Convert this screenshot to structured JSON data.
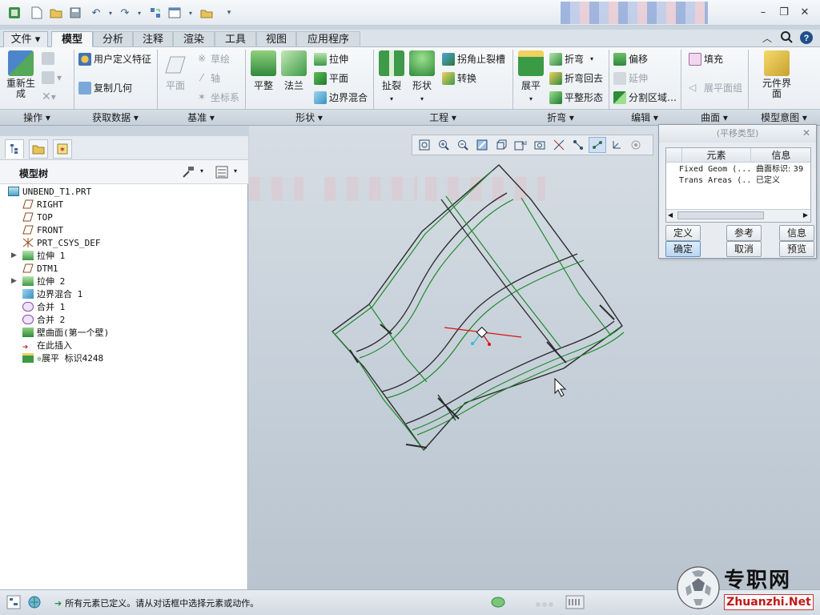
{
  "tabs": {
    "file": "文件",
    "model": "模型",
    "analysis": "分析",
    "annotate": "注释",
    "render": "渲染",
    "tools": "工具",
    "view": "视图",
    "applications": "应用程序"
  },
  "ribbon": {
    "operations": {
      "regenerate": "重新生成",
      "label": "操作"
    },
    "get_data": {
      "udf": "用户定义特征",
      "copy_geom": "复制几何",
      "label": "获取数据"
    },
    "datum": {
      "plane": "平面",
      "sketch": "草绘",
      "axis": "轴",
      "csys": "坐标系",
      "label": "基准"
    },
    "shapes": {
      "flat": "平整",
      "flange": "法兰",
      "extrude": "拉伸",
      "planar": "平面",
      "blend": "边界混合",
      "label": "形状"
    },
    "engineering": {
      "rip": "扯裂",
      "form": "形状",
      "corner_relief": "拐角止裂槽",
      "convert": "转换",
      "label": "工程"
    },
    "bends": {
      "unbend": "展平",
      "bend": "折弯",
      "bend_back": "折弯回去",
      "flatten_form": "平整形态",
      "label": "折弯"
    },
    "editing": {
      "offset": "偏移",
      "extend": "延伸",
      "split_area": "分割区域…",
      "label": "编辑"
    },
    "surfaces": {
      "fill": "填充",
      "flat_pattern": "展平面组",
      "label": "曲面"
    },
    "model_intent": {
      "component_interface": "元件界面",
      "label": "模型意图"
    }
  },
  "model_tree": {
    "title": "模型树",
    "items": [
      {
        "label": "UNBEND_T1.PRT"
      },
      {
        "label": "RIGHT"
      },
      {
        "label": "TOP"
      },
      {
        "label": "FRONT"
      },
      {
        "label": "PRT_CSYS_DEF"
      },
      {
        "label": "拉伸 1"
      },
      {
        "label": "DTM1"
      },
      {
        "label": "拉伸 2"
      },
      {
        "label": "边界混合 1"
      },
      {
        "label": "合并 1"
      },
      {
        "label": "合并 2"
      },
      {
        "label": "壁曲面(第一个壁)"
      },
      {
        "label": "在此插入"
      },
      {
        "label": "展平 标识4248"
      }
    ]
  },
  "dialog": {
    "title": "(平移类型)",
    "col_element": "元素",
    "col_info": "信息",
    "rows": [
      {
        "element": "Fixed Geom (...",
        "info": "曲面标识: 39"
      },
      {
        "element": "Trans Areas (...",
        "info": "已定义"
      }
    ],
    "btn_define": "定义",
    "btn_refs": "参考",
    "btn_info": "信息",
    "btn_ok": "确定",
    "btn_cancel": "取消",
    "btn_preview": "预览"
  },
  "status": {
    "message": "所有元素已定义。请从对话框中选择元素或动作。"
  },
  "watermark": {
    "brand": "专职网",
    "url": "Zhuanzhi.Net"
  },
  "colors": {
    "accent": "#3a7ab8",
    "model_green": "#1f8a2a",
    "model_dark": "#2a2a2a"
  }
}
